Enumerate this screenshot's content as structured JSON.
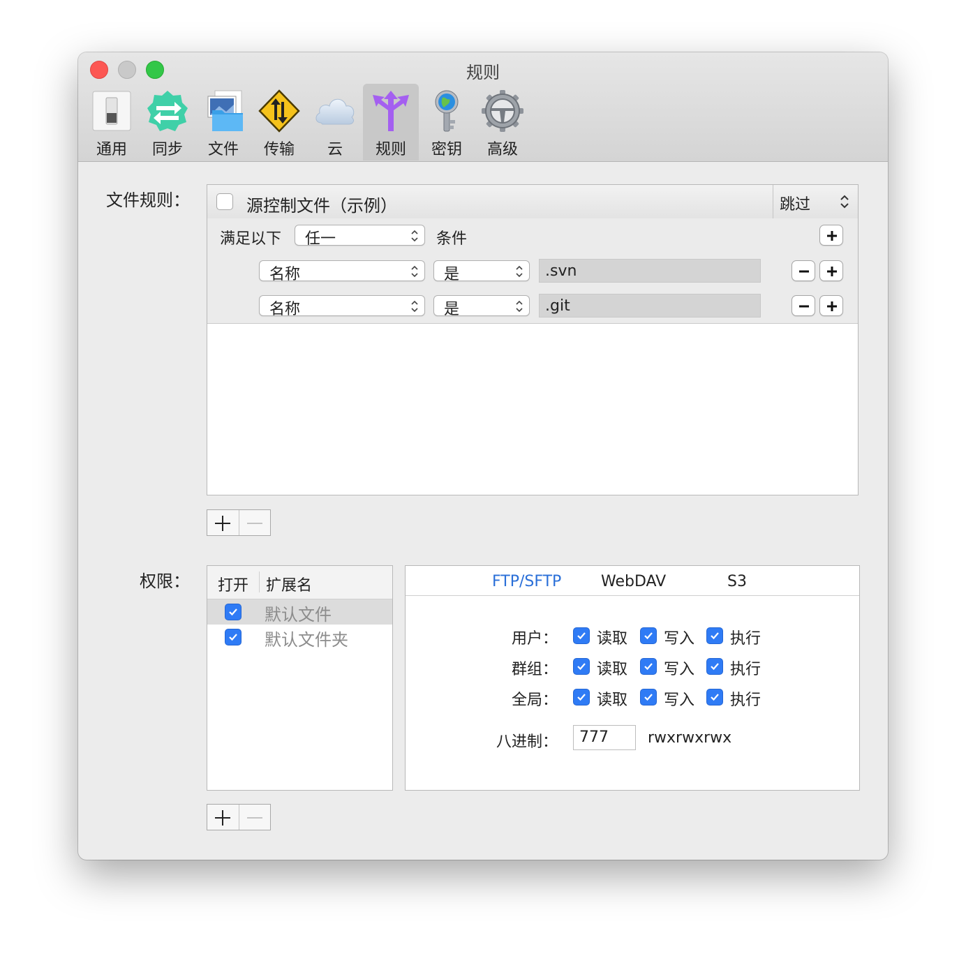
{
  "window": {
    "title": "规则"
  },
  "toolbar": {
    "items": [
      {
        "label": "通用",
        "icon": "switch-icon"
      },
      {
        "label": "同步",
        "icon": "sync-icon"
      },
      {
        "label": "文件",
        "icon": "files-icon"
      },
      {
        "label": "传输",
        "icon": "transfer-icon"
      },
      {
        "label": "云",
        "icon": "cloud-icon"
      },
      {
        "label": "规则",
        "icon": "rules-arrows-icon",
        "selected": true
      },
      {
        "label": "密钥",
        "icon": "key-icon"
      },
      {
        "label": "高级",
        "icon": "gear-icon"
      }
    ]
  },
  "file_rules": {
    "section_label": "文件规则：",
    "rule": {
      "checked": false,
      "name": "源控制文件（示例）",
      "action": "跳过"
    },
    "match": {
      "prefix": "满足以下",
      "mode": "任一",
      "suffix": "条件"
    },
    "conditions": [
      {
        "field": "名称",
        "operator": "是",
        "value": ".svn"
      },
      {
        "field": "名称",
        "operator": "是",
        "value": ".git"
      }
    ]
  },
  "permissions": {
    "section_label": "权限：",
    "columns": {
      "open": "打开",
      "ext": "扩展名"
    },
    "rows": [
      {
        "checked": true,
        "name": "默认文件",
        "selected": true
      },
      {
        "checked": true,
        "name": "默认文件夹",
        "selected": false
      }
    ],
    "tabs": [
      "FTP/SFTP",
      "WebDAV",
      "S3"
    ],
    "active_tab": "FTP/SFTP",
    "groups": [
      {
        "label": "用户：",
        "read": true,
        "write": true,
        "exec": true
      },
      {
        "label": "群组：",
        "read": true,
        "write": true,
        "exec": true
      },
      {
        "label": "全局：",
        "read": true,
        "write": true,
        "exec": true
      }
    ],
    "perm_names": {
      "read": "读取",
      "write": "写入",
      "exec": "执行"
    },
    "octal_label": "八进制：",
    "octal_value": "777",
    "symbolic": "rwxrwxrwx"
  },
  "colors": {
    "accent": "#2f7bf5",
    "tab_active": "#2a6fd8",
    "close": "#fc5753",
    "zoom": "#33c748"
  }
}
